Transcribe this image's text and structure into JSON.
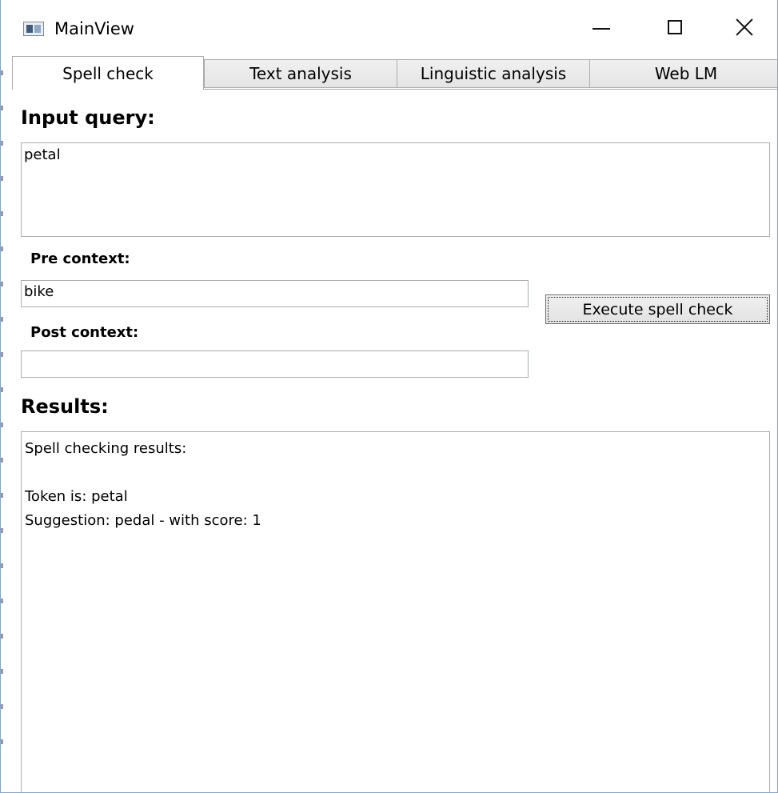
{
  "window": {
    "title": "MainView",
    "icon": "app-window-icon",
    "controls": [
      "minimize-icon",
      "maximize-icon",
      "close-icon"
    ]
  },
  "tabs": [
    {
      "label": "Spell check",
      "selected": true
    },
    {
      "label": "Text analysis",
      "selected": false
    },
    {
      "label": "Linguistic analysis",
      "selected": false
    },
    {
      "label": "Web LM",
      "selected": false
    }
  ],
  "spell_check": {
    "input_query_heading": "Input query:",
    "input_query_value": "petal",
    "pre_context_label": "Pre context:",
    "pre_context_value": "bike",
    "post_context_label": "Post context:",
    "post_context_value": "",
    "execute_button_label": "Execute spell check",
    "results_heading": "Results:",
    "results_lines": [
      "Spell checking results:",
      "",
      "Token is: petal",
      "Suggestion: pedal - with score: 1"
    ]
  }
}
